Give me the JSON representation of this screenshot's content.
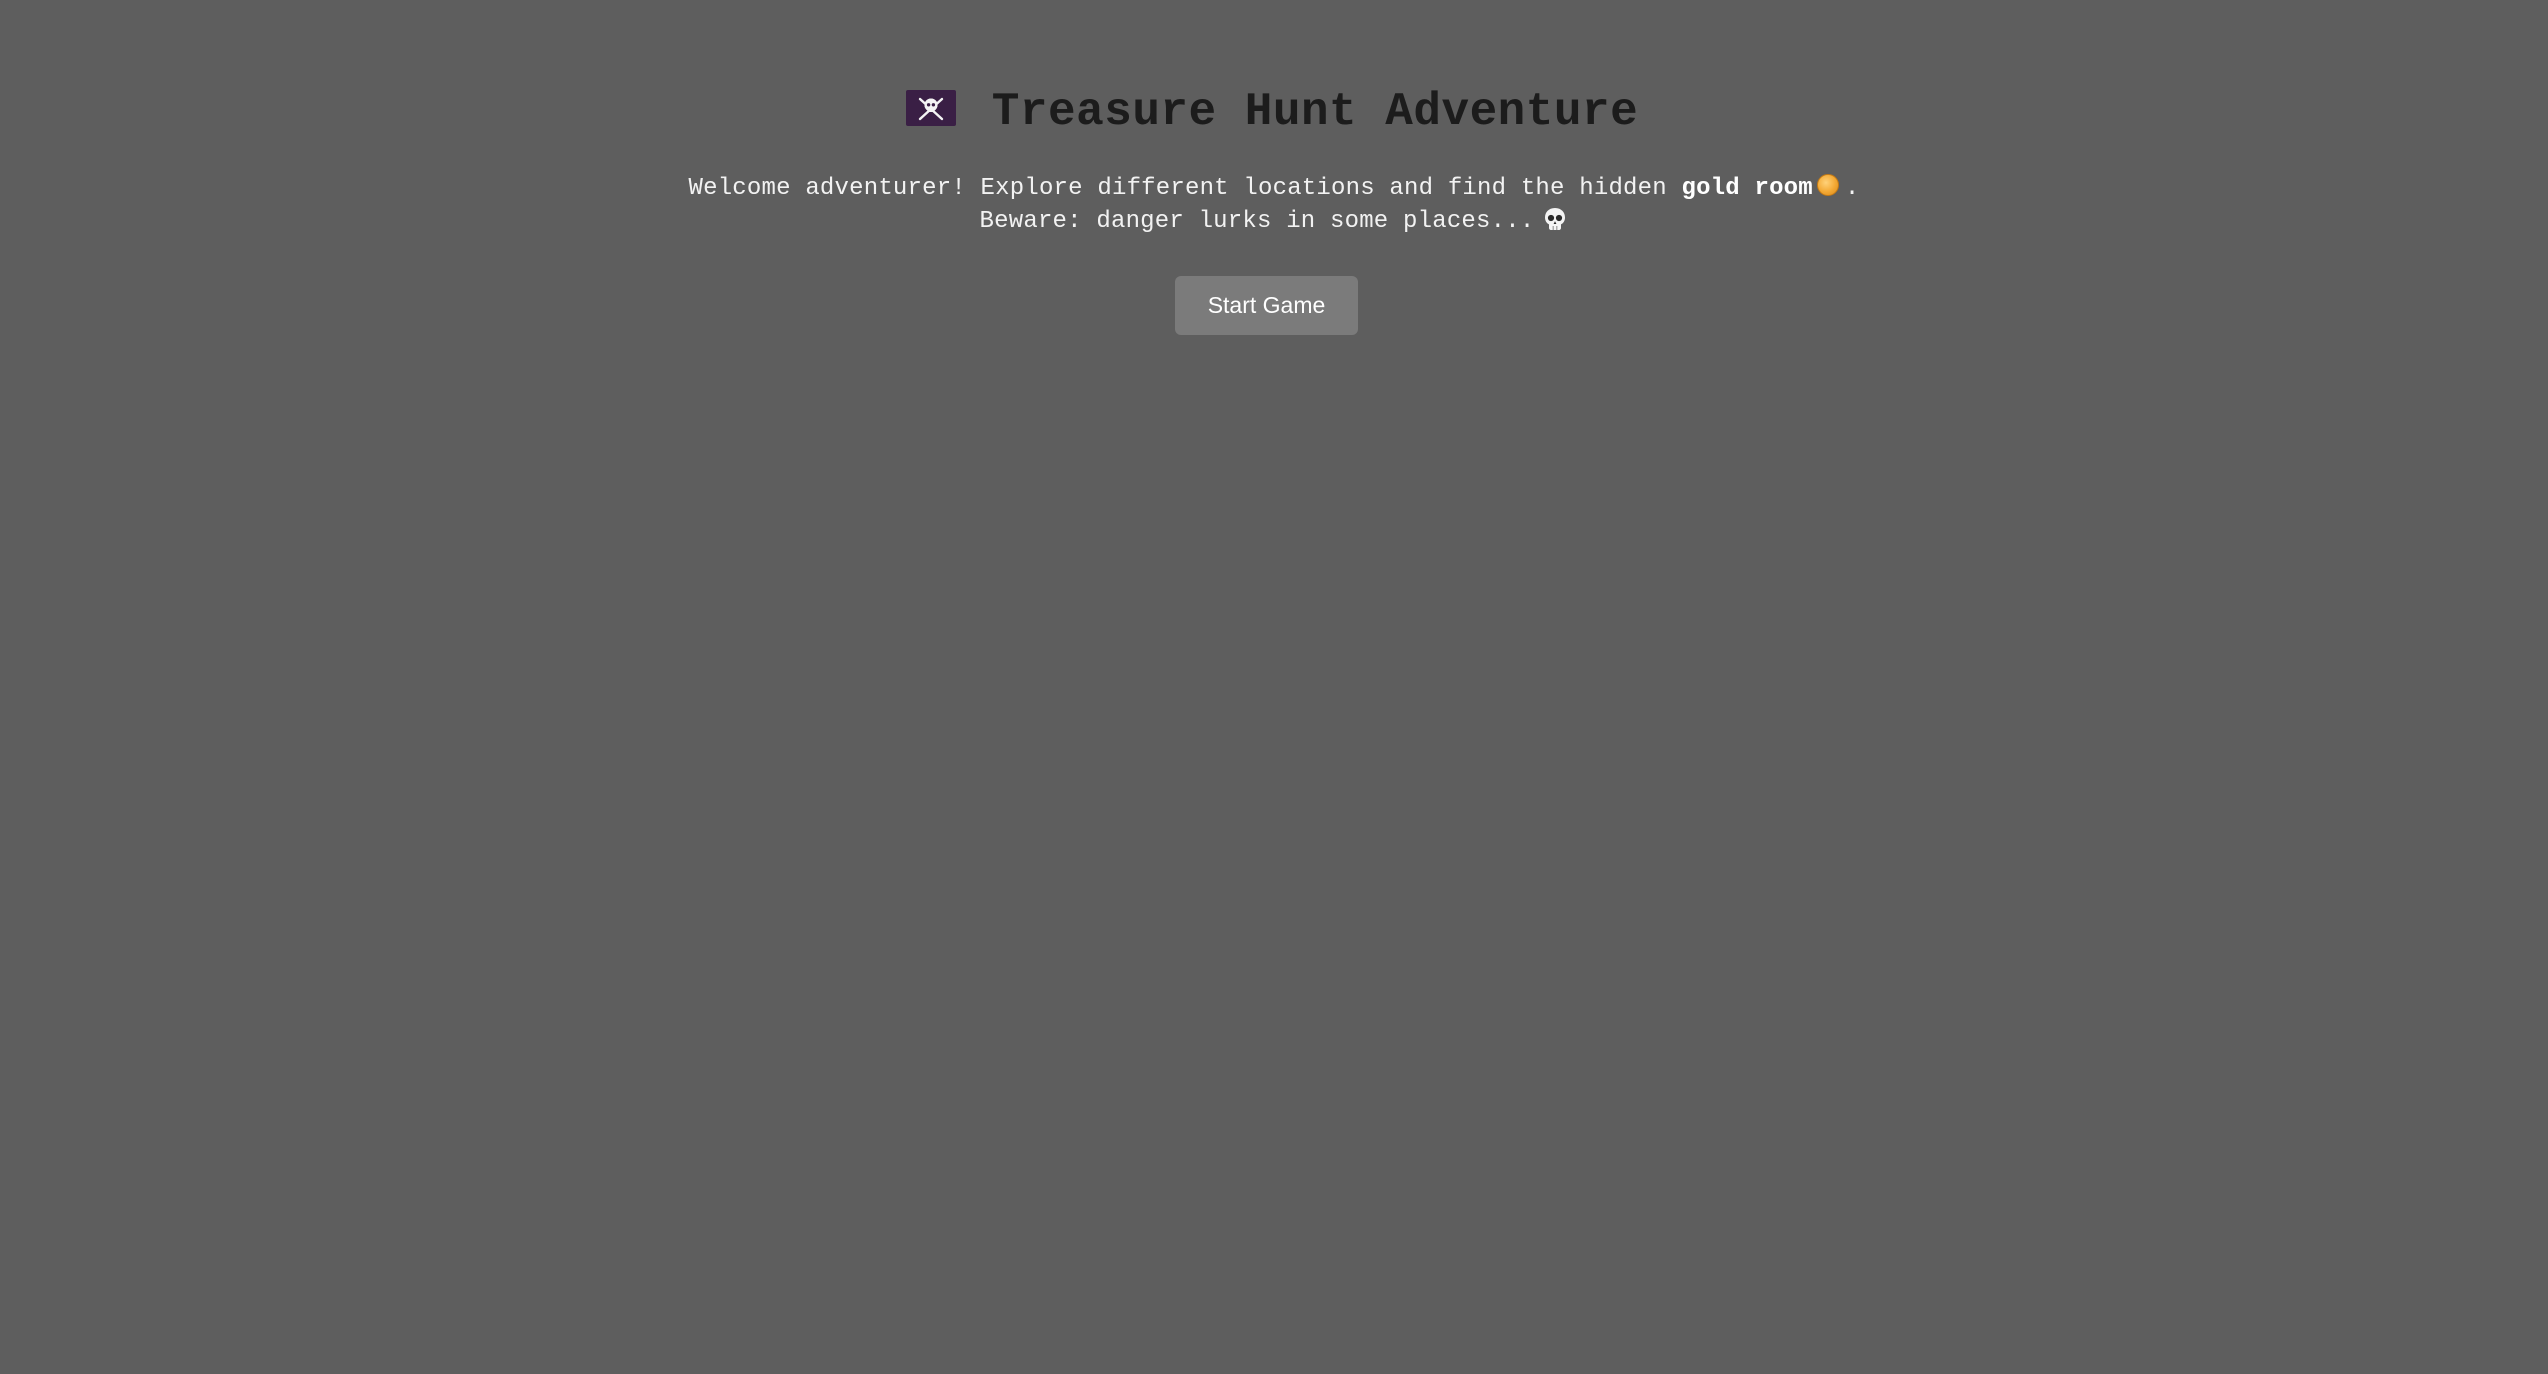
{
  "header": {
    "title": "Treasure Hunt Adventure",
    "flag_icon": "pirate-flag-icon"
  },
  "intro": {
    "line1_text": "Welcome adventurer! Explore different locations and find the hidden ",
    "line1_bold": "gold room",
    "line1_icon": "gold-coin-icon",
    "line1_end": ".",
    "line2_text": "Beware: danger lurks in some places...",
    "line2_icon": "skull-icon"
  },
  "actions": {
    "start_label": "Start Game"
  },
  "colors": {
    "background": "#5e5e5e",
    "title": "#1c1c1c",
    "text": "#f2f2f2",
    "button": "#7b7b7b",
    "flag": "#3a1f45",
    "coin": "#f3a833"
  }
}
